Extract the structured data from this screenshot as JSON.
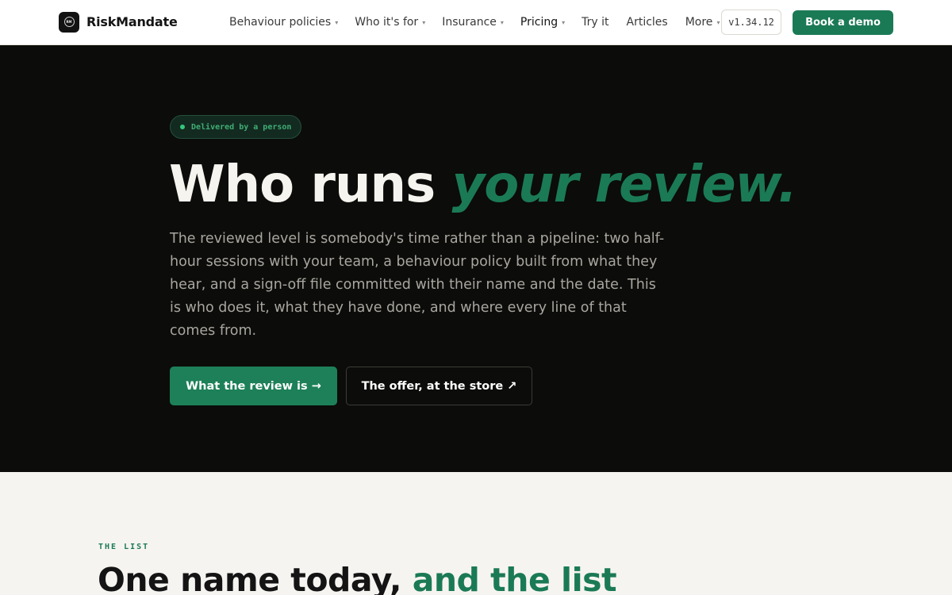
{
  "brand": {
    "name": "RiskMandate",
    "mark": "RM"
  },
  "nav": {
    "items": [
      {
        "label": "Behaviour policies",
        "caret": "▾"
      },
      {
        "label": "Who it's for",
        "caret": "▾"
      },
      {
        "label": "Insurance",
        "caret": "▾"
      },
      {
        "label": "Pricing",
        "caret": "▾"
      },
      {
        "label": "Try it"
      },
      {
        "label": "Articles"
      },
      {
        "label": "More",
        "caret": "▾"
      }
    ],
    "version": "v1.34.12",
    "cta": "Book a demo"
  },
  "hero": {
    "badge": "Delivered by a person",
    "title_plain": "Who runs",
    "title_accent": "your review.",
    "body": "The reviewed level is somebody's time rather than a pipeline: two half-hour sessions with your team, a behaviour policy built from what they hear, and a sign-off file committed with their name and the date. This is who does it, what they have done, and where every line of that comes from.",
    "primary_cta": "What the review is →",
    "secondary_cta": "The offer, at the store ↗"
  },
  "list": {
    "eyebrow": "THE LIST",
    "title_plain": "One name today,",
    "title_accent": "and the list"
  },
  "colors": {
    "accent": "#1b7a56",
    "hero_bg": "#0c0c0a",
    "page_bg": "#f6f4f1"
  }
}
